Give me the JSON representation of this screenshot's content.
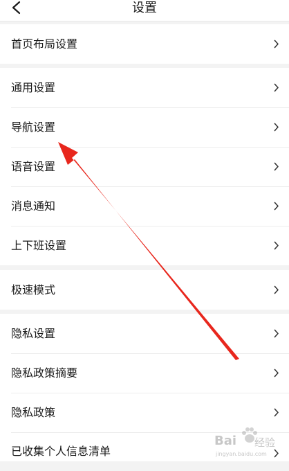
{
  "header": {
    "title": "设置"
  },
  "groups": [
    {
      "items": [
        "首页布局设置"
      ]
    },
    {
      "items": [
        "通用设置",
        "导航设置",
        "语音设置",
        "消息通知",
        "上下班设置"
      ]
    },
    {
      "items": [
        "极速模式"
      ]
    },
    {
      "items": [
        "隐私设置",
        "隐私政策摘要",
        "隐私政策",
        "已收集个人信息清单"
      ]
    }
  ],
  "icons": {
    "back": "chevron-left-icon",
    "row_arrow": "chevron-right-icon"
  },
  "colors": {
    "background": "#f3f3f3",
    "surface": "#ffffff",
    "text": "#1a1a1a",
    "arrow_annotation": "#e8271d"
  },
  "watermark": {
    "brand": "Bai",
    "brand_suffix": "经验",
    "domain": "jingyan.baidu.com"
  }
}
